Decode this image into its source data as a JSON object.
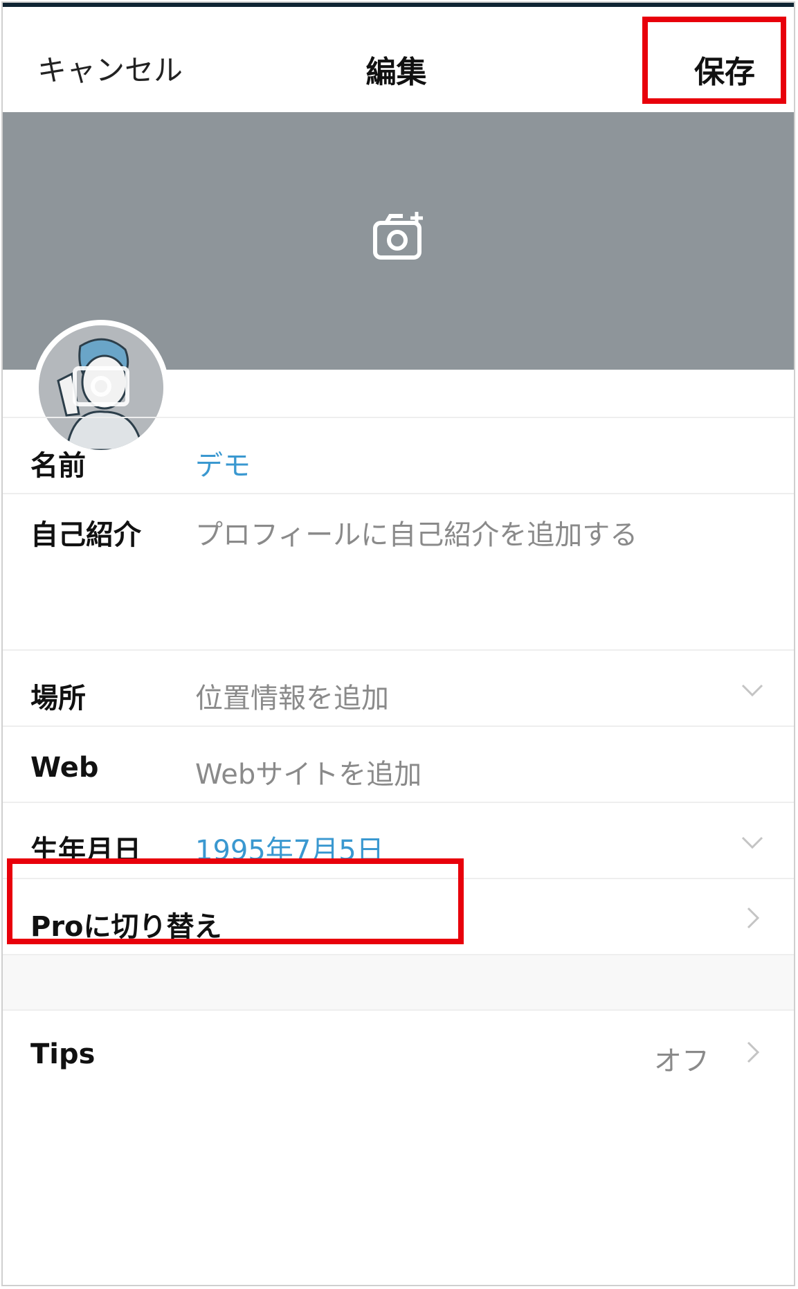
{
  "nav": {
    "cancel_label": "キャンセル",
    "title": "編集",
    "save_label": "保存"
  },
  "header": {
    "camera_icon": "camera-plus-icon",
    "background_color": "#8e959a"
  },
  "profile": {
    "avatar_icon": "camera-plus-icon"
  },
  "fields": {
    "name": {
      "label": "名前",
      "value": "デモ"
    },
    "bio": {
      "label": "自己紹介",
      "placeholder": "プロフィールに自己紹介を追加する"
    },
    "location": {
      "label": "場所",
      "placeholder": "位置情報を追加"
    },
    "web": {
      "label": "Web",
      "placeholder": "Webサイトを追加"
    },
    "birthday": {
      "label": "生年月日",
      "value": "1995年7月5日"
    },
    "pro": {
      "label": "Proに切り替え"
    },
    "tips": {
      "label": "Tips",
      "value": "オフ"
    }
  },
  "colors": {
    "accent_blue": "#3a98d0",
    "highlight_red": "#e8000b",
    "placeholder_gray": "#8a8a8a"
  }
}
